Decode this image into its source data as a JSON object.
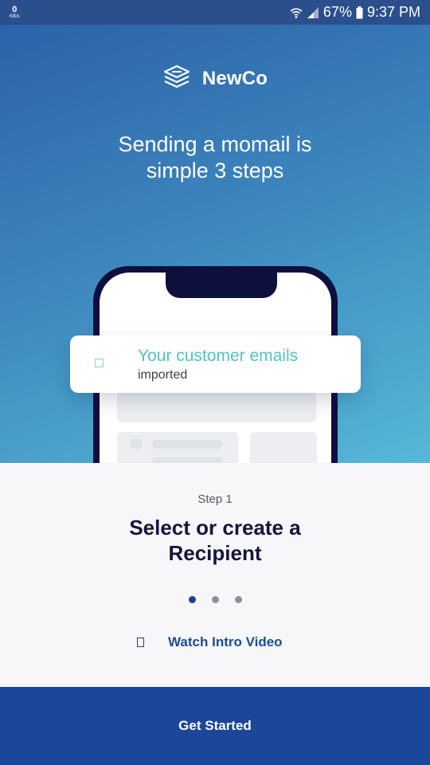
{
  "status_bar": {
    "net_speed": "0",
    "net_unit": "KB/s",
    "battery": "67%",
    "time": "9:37 PM"
  },
  "brand": {
    "name": "NewCo",
    "logo_icon": "stacked-layers-icon"
  },
  "headline": {
    "line1": "Sending a momail is",
    "line2": "simple 3 steps"
  },
  "illustration": {
    "card_title": "Your customer emails",
    "card_subtitle": "imported"
  },
  "step": {
    "label": "Step 1",
    "title_line1": "Select or create a",
    "title_line2": "Recipient"
  },
  "pager": {
    "total": 3,
    "active": 1
  },
  "video_link": {
    "label": "Watch Intro Video",
    "icon": "play-icon"
  },
  "cta": {
    "label": "Get Started"
  },
  "colors": {
    "primary": "#1b4699",
    "gradient_start": "#2d62a8",
    "gradient_end": "#56b8d6",
    "accent_teal": "#4fc3c9",
    "title_navy": "#14163e"
  }
}
